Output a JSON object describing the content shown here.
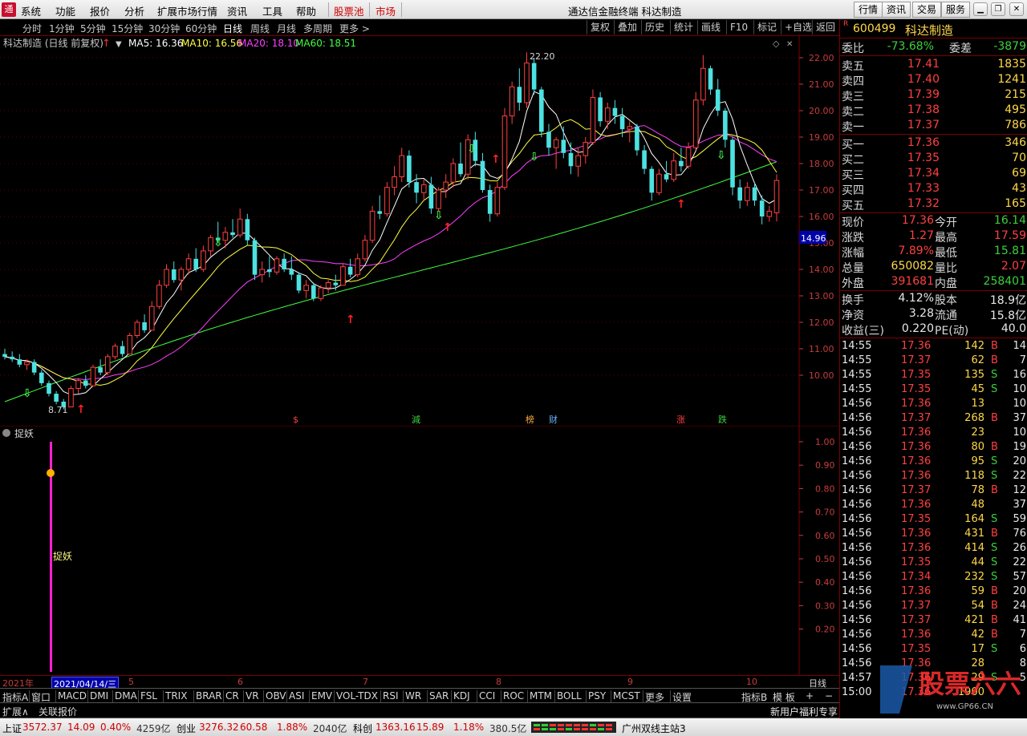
{
  "menubar": {
    "logo": "通",
    "items": [
      "系统",
      "功能",
      "报价",
      "分析",
      "扩展市场行情",
      "资讯",
      "工具",
      "帮助"
    ],
    "highlight_items": [
      "股票池",
      "市场"
    ],
    "title": "通达信金融终端  科达制造",
    "right_buttons": [
      "行情",
      "资讯",
      "交易",
      "服务"
    ]
  },
  "periodbar": {
    "periods": [
      "分时",
      "1分钟",
      "5分钟",
      "15分钟",
      "30分钟",
      "60分钟",
      "日线",
      "周线",
      "月线",
      "多周期",
      "更多 >"
    ],
    "active": "日线",
    "tools": [
      "复权",
      "叠加",
      "历史",
      "统计",
      "画线",
      "F10",
      "标记",
      "+自选",
      "返回"
    ]
  },
  "mainchart": {
    "title": "科达制造 (日线 前复权)",
    "ma_labels": [
      {
        "text": "MA5: 16.36",
        "color": "#ffffff"
      },
      {
        "text": "MA10: 16.56",
        "color": "#ffff40"
      },
      {
        "text": "MA20: 18.10",
        "color": "#ff40ff"
      },
      {
        "text": "MA60: 18.51",
        "color": "#40ff40"
      }
    ],
    "price_axis": [
      "22.00",
      "21.00",
      "20.00",
      "19.00",
      "18.00",
      "17.00",
      "16.00",
      "15.00",
      "14.00",
      "13.00",
      "12.00",
      "11.00",
      "10.00"
    ],
    "current_price_tag": "14.96",
    "high_label": "22.20",
    "low_label": "8.71",
    "event_marks": [
      {
        "text": "$",
        "color": "#ff4040"
      },
      {
        "text": "減",
        "color": "#3cd03c"
      },
      {
        "text": "榜",
        "color": "#ffaa40"
      },
      {
        "text": "财",
        "color": "#6ab4ff"
      },
      {
        "text": "涨",
        "color": "#ff4040"
      },
      {
        "text": "跌",
        "color": "#3cd03c"
      }
    ]
  },
  "subchart": {
    "title": "捉妖",
    "signal_label": "捉妖",
    "axis": [
      "1.00",
      "0.90",
      "0.80",
      "0.70",
      "0.60",
      "0.50",
      "0.40",
      "0.30",
      "0.20"
    ]
  },
  "datebar": {
    "year": "2021年",
    "cursor_date": "2021/04/14/三",
    "months": [
      "5",
      "6",
      "7",
      "8",
      "9",
      "10"
    ],
    "right_label": "日线"
  },
  "indicators": {
    "first": "指标A",
    "items": [
      "窗口",
      "MACD",
      "DMI",
      "DMA",
      "FSL",
      "TRIX",
      "BRAR",
      "CR",
      "VR",
      "OBV",
      "ASI",
      "EMV",
      "VOL-TDX",
      "RSI",
      "WR",
      "SAR",
      "KDJ",
      "CCI",
      "ROC",
      "MTM",
      "BOLL",
      "PSY",
      "MCST",
      "更多",
      "设置"
    ],
    "right_items": [
      "指标B",
      "模 板",
      "+",
      "−"
    ]
  },
  "extbar": {
    "items": [
      "扩展∧",
      "关联报价"
    ],
    "promo": "新用户福利专享"
  },
  "statusbar": {
    "sh_label": "上证",
    "sh_value": "3572.37",
    "sh_change": "14.09",
    "sh_pct": "0.40%",
    "sh_amount": "4259亿",
    "cy_label": "创业",
    "cy_value": "3276.32",
    "cy_change": "60.58",
    "cy_pct": "1.88%",
    "cy_amount": "2040亿",
    "kc_label": "科创",
    "kc_value": "1363.16",
    "kc_change": "15.89",
    "kc_pct": "1.18%",
    "kc_amount": "380.5亿",
    "server": "广州双线主站3"
  },
  "quote": {
    "badge": "R",
    "code": "600499",
    "name": "科达制造",
    "weibi_label": "委比",
    "weibi": "-73.68%",
    "weicha_label": "委差",
    "weicha": "-3879",
    "asks": [
      {
        "label": "卖五",
        "price": "17.41",
        "vol": "1835"
      },
      {
        "label": "卖四",
        "price": "17.40",
        "vol": "1241"
      },
      {
        "label": "卖三",
        "price": "17.39",
        "vol": "215"
      },
      {
        "label": "卖二",
        "price": "17.38",
        "vol": "495"
      },
      {
        "label": "卖一",
        "price": "17.37",
        "vol": "786"
      }
    ],
    "bids": [
      {
        "label": "买一",
        "price": "17.36",
        "vol": "346"
      },
      {
        "label": "买二",
        "price": "17.35",
        "vol": "70"
      },
      {
        "label": "买三",
        "price": "17.34",
        "vol": "69"
      },
      {
        "label": "买四",
        "price": "17.33",
        "vol": "43"
      },
      {
        "label": "买五",
        "price": "17.32",
        "vol": "165"
      }
    ],
    "stats": [
      {
        "l1": "现价",
        "v1": "17.36",
        "c1": "up",
        "l2": "今开",
        "v2": "16.14",
        "c2": "down"
      },
      {
        "l1": "涨跌",
        "v1": "1.27",
        "c1": "up",
        "l2": "最高",
        "v2": "17.59",
        "c2": "up"
      },
      {
        "l1": "涨幅",
        "v1": "7.89%",
        "c1": "up",
        "l2": "最低",
        "v2": "15.81",
        "c2": "down"
      },
      {
        "l1": "总量",
        "v1": "650082",
        "c1": "yel",
        "l2": "量比",
        "v2": "2.07",
        "c2": "up"
      },
      {
        "l1": "外盘",
        "v1": "391681",
        "c1": "up",
        "l2": "内盘",
        "v2": "258401",
        "c2": "down"
      }
    ],
    "stats2": [
      {
        "l1": "换手",
        "v1": "4.12%",
        "l2": "股本",
        "v2": "18.9亿"
      },
      {
        "l1": "净资",
        "v1": "3.28",
        "l2": "流通",
        "v2": "15.8亿"
      },
      {
        "l1": "收益(三)",
        "v1": "0.220",
        "l2": "PE(动)",
        "v2": "40.0"
      }
    ]
  },
  "ticks": [
    {
      "t": "14:55",
      "p": "17.36",
      "pc": "up",
      "v": "142",
      "d": "B",
      "n": "14"
    },
    {
      "t": "14:55",
      "p": "17.37",
      "pc": "up",
      "v": "62",
      "d": "B",
      "n": "7"
    },
    {
      "t": "14:55",
      "p": "17.35",
      "pc": "up",
      "v": "135",
      "d": "S",
      "n": "16"
    },
    {
      "t": "14:55",
      "p": "17.35",
      "pc": "up",
      "v": "45",
      "d": "S",
      "n": "10"
    },
    {
      "t": "14:56",
      "p": "17.36",
      "pc": "up",
      "v": "13",
      "d": "",
      "n": "10"
    },
    {
      "t": "14:56",
      "p": "17.37",
      "pc": "up",
      "v": "268",
      "d": "B",
      "n": "37"
    },
    {
      "t": "14:56",
      "p": "17.36",
      "pc": "up",
      "v": "23",
      "d": "",
      "n": "10"
    },
    {
      "t": "14:56",
      "p": "17.36",
      "pc": "up",
      "v": "80",
      "d": "B",
      "n": "19"
    },
    {
      "t": "14:56",
      "p": "17.36",
      "pc": "up",
      "v": "95",
      "d": "S",
      "n": "20"
    },
    {
      "t": "14:56",
      "p": "17.36",
      "pc": "up",
      "v": "118",
      "d": "S",
      "n": "22"
    },
    {
      "t": "14:56",
      "p": "17.37",
      "pc": "up",
      "v": "78",
      "d": "B",
      "n": "12"
    },
    {
      "t": "14:56",
      "p": "17.36",
      "pc": "up",
      "v": "48",
      "d": "",
      "n": "37"
    },
    {
      "t": "14:56",
      "p": "17.35",
      "pc": "up",
      "v": "164",
      "d": "S",
      "n": "59"
    },
    {
      "t": "14:56",
      "p": "17.36",
      "pc": "up",
      "v": "431",
      "d": "B",
      "n": "76"
    },
    {
      "t": "14:56",
      "p": "17.36",
      "pc": "up",
      "v": "414",
      "d": "S",
      "n": "26"
    },
    {
      "t": "14:56",
      "p": "17.35",
      "pc": "up",
      "v": "44",
      "d": "S",
      "n": "22"
    },
    {
      "t": "14:56",
      "p": "17.34",
      "pc": "up",
      "v": "232",
      "d": "S",
      "n": "57"
    },
    {
      "t": "14:56",
      "p": "17.36",
      "pc": "up",
      "v": "59",
      "d": "B",
      "n": "20"
    },
    {
      "t": "14:56",
      "p": "17.37",
      "pc": "up",
      "v": "54",
      "d": "B",
      "n": "24"
    },
    {
      "t": "14:56",
      "p": "17.37",
      "pc": "up",
      "v": "421",
      "d": "B",
      "n": "41"
    },
    {
      "t": "14:56",
      "p": "17.36",
      "pc": "up",
      "v": "42",
      "d": "B",
      "n": "7"
    },
    {
      "t": "14:56",
      "p": "17.35",
      "pc": "up",
      "v": "17",
      "d": "S",
      "n": "6"
    },
    {
      "t": "14:56",
      "p": "17.36",
      "pc": "up",
      "v": "28",
      "d": "",
      "n": "8"
    },
    {
      "t": "14:57",
      "p": "17.36",
      "pc": "up",
      "v": "29",
      "d": "S",
      "n": "5"
    },
    {
      "t": "15:00",
      "p": "17.36",
      "pc": "up",
      "v": "1900",
      "d": "",
      "n": ""
    }
  ],
  "watermark": "股票六六",
  "watermark_url": "www.GP66.CN",
  "colors": {
    "up": "#ff4040",
    "down": "#4de1e1",
    "ma5": "#ffffff",
    "ma10": "#ffff40",
    "ma20": "#ff40ff",
    "ma60": "#40ff40",
    "grid": "#7a0000"
  },
  "chart_data": {
    "type": "candlestick",
    "title": "科达制造 (日线 前复权)",
    "ylim": [
      8.5,
      22.5
    ],
    "x_months": [
      "4",
      "5",
      "6",
      "7",
      "8",
      "9",
      "10"
    ],
    "candles": [
      [
        10.8,
        11.0,
        10.6,
        10.7
      ],
      [
        10.7,
        10.9,
        10.5,
        10.6
      ],
      [
        10.6,
        10.8,
        10.3,
        10.4
      ],
      [
        10.4,
        10.6,
        10.2,
        10.5
      ],
      [
        10.5,
        10.6,
        10.0,
        10.1
      ],
      [
        10.1,
        10.2,
        9.6,
        9.7
      ],
      [
        9.7,
        9.8,
        9.2,
        9.3
      ],
      [
        9.3,
        9.4,
        8.9,
        9.0
      ],
      [
        9.0,
        9.1,
        8.71,
        8.8
      ],
      [
        8.8,
        9.6,
        8.8,
        9.5
      ],
      [
        9.5,
        9.9,
        9.3,
        9.8
      ],
      [
        9.8,
        10.0,
        9.5,
        9.6
      ],
      [
        9.6,
        10.4,
        9.6,
        10.3
      ],
      [
        10.3,
        10.6,
        10.0,
        10.1
      ],
      [
        10.1,
        10.8,
        10.0,
        10.7
      ],
      [
        10.7,
        11.2,
        10.6,
        11.1
      ],
      [
        11.1,
        11.3,
        10.7,
        10.8
      ],
      [
        10.8,
        11.6,
        10.8,
        11.5
      ],
      [
        11.5,
        12.1,
        11.4,
        12.0
      ],
      [
        12.0,
        12.3,
        11.6,
        11.7
      ],
      [
        11.7,
        12.8,
        11.7,
        12.6
      ],
      [
        12.6,
        13.6,
        12.5,
        13.4
      ],
      [
        13.4,
        14.2,
        13.3,
        14.0
      ],
      [
        14.0,
        14.3,
        13.5,
        13.6
      ],
      [
        13.6,
        14.1,
        13.2,
        14.0
      ],
      [
        14.0,
        14.6,
        13.8,
        14.4
      ],
      [
        14.4,
        14.8,
        13.9,
        14.0
      ],
      [
        14.0,
        14.9,
        13.9,
        14.7
      ],
      [
        14.7,
        15.3,
        14.5,
        15.2
      ],
      [
        15.2,
        15.8,
        15.0,
        15.1
      ],
      [
        15.1,
        15.6,
        14.8,
        15.4
      ],
      [
        15.4,
        15.9,
        15.2,
        15.3
      ],
      [
        15.3,
        16.3,
        15.2,
        15.9
      ],
      [
        15.9,
        16.1,
        14.9,
        15.1
      ],
      [
        15.1,
        15.2,
        13.6,
        13.8
      ],
      [
        13.8,
        14.3,
        13.5,
        14.0
      ],
      [
        14.0,
        14.5,
        13.7,
        13.9
      ],
      [
        13.9,
        14.5,
        13.8,
        14.4
      ],
      [
        14.4,
        14.6,
        13.9,
        14.0
      ],
      [
        14.0,
        14.5,
        13.6,
        13.8
      ],
      [
        13.8,
        13.9,
        13.1,
        13.2
      ],
      [
        13.2,
        13.6,
        12.9,
        13.4
      ],
      [
        13.4,
        13.5,
        12.8,
        12.9
      ],
      [
        12.9,
        13.4,
        12.8,
        13.3
      ],
      [
        13.3,
        13.6,
        13.1,
        13.5
      ],
      [
        13.5,
        13.8,
        13.2,
        13.4
      ],
      [
        13.4,
        14.2,
        13.4,
        14.1
      ],
      [
        14.1,
        14.4,
        13.7,
        13.8
      ],
      [
        13.8,
        14.6,
        13.7,
        14.4
      ],
      [
        14.4,
        15.3,
        14.3,
        15.1
      ],
      [
        15.1,
        16.4,
        15.0,
        16.2
      ],
      [
        16.2,
        16.8,
        15.9,
        16.1
      ],
      [
        16.1,
        17.3,
        16.0,
        17.1
      ],
      [
        17.1,
        17.9,
        16.8,
        17.5
      ],
      [
        17.5,
        18.6,
        17.3,
        18.3
      ],
      [
        18.3,
        18.5,
        17.1,
        17.3
      ],
      [
        17.3,
        17.6,
        16.5,
        16.9
      ],
      [
        16.9,
        17.4,
        16.6,
        17.2
      ],
      [
        17.2,
        17.5,
        16.1,
        16.3
      ],
      [
        16.3,
        17.1,
        16.2,
        17.0
      ],
      [
        17.0,
        17.6,
        16.7,
        17.3
      ],
      [
        17.3,
        18.2,
        17.1,
        18.0
      ],
      [
        18.0,
        18.8,
        17.5,
        17.6
      ],
      [
        17.6,
        19.1,
        17.4,
        18.9
      ],
      [
        18.9,
        19.2,
        17.9,
        18.1
      ],
      [
        18.1,
        18.4,
        16.9,
        17.0
      ],
      [
        17.0,
        17.2,
        15.8,
        16.1
      ],
      [
        16.1,
        17.3,
        16.0,
        17.1
      ],
      [
        17.1,
        20.1,
        17.0,
        19.8
      ],
      [
        19.8,
        21.1,
        19.5,
        20.9
      ],
      [
        20.9,
        21.6,
        20.0,
        20.3
      ],
      [
        20.3,
        22.2,
        20.1,
        21.8
      ],
      [
        21.8,
        22.0,
        20.6,
        20.8
      ],
      [
        20.8,
        20.9,
        19.0,
        19.2
      ],
      [
        19.2,
        19.5,
        18.3,
        18.6
      ],
      [
        18.6,
        19.0,
        17.8,
        18.9
      ],
      [
        18.9,
        19.4,
        18.2,
        18.4
      ],
      [
        18.4,
        18.8,
        17.6,
        17.9
      ],
      [
        17.9,
        18.6,
        17.5,
        18.3
      ],
      [
        18.3,
        19.0,
        18.0,
        18.8
      ],
      [
        18.8,
        20.8,
        18.7,
        20.5
      ],
      [
        20.5,
        20.7,
        19.4,
        19.6
      ],
      [
        19.6,
        20.3,
        19.3,
        20.1
      ],
      [
        20.1,
        20.4,
        19.5,
        19.8
      ],
      [
        19.8,
        20.1,
        19.0,
        19.3
      ],
      [
        19.3,
        19.6,
        18.8,
        19.4
      ],
      [
        19.4,
        19.5,
        18.3,
        18.5
      ],
      [
        18.5,
        18.7,
        17.6,
        17.8
      ],
      [
        17.8,
        17.9,
        16.6,
        16.9
      ],
      [
        16.9,
        17.8,
        16.8,
        17.6
      ],
      [
        17.6,
        18.1,
        17.3,
        17.4
      ],
      [
        17.4,
        18.4,
        17.3,
        18.1
      ],
      [
        18.1,
        18.6,
        17.7,
        17.9
      ],
      [
        17.9,
        18.8,
        17.8,
        18.6
      ],
      [
        18.6,
        20.7,
        18.5,
        20.4
      ],
      [
        20.4,
        22.1,
        20.2,
        21.6
      ],
      [
        21.6,
        21.7,
        20.6,
        20.8
      ],
      [
        20.8,
        21.2,
        19.8,
        20.0
      ],
      [
        20.0,
        20.1,
        18.6,
        18.9
      ],
      [
        18.9,
        19.0,
        16.8,
        17.1
      ],
      [
        17.1,
        17.4,
        16.3,
        16.6
      ],
      [
        16.6,
        17.3,
        16.4,
        17.1
      ],
      [
        17.1,
        17.3,
        16.4,
        16.6
      ],
      [
        16.6,
        16.8,
        15.7,
        16.0
      ],
      [
        16.0,
        16.4,
        15.8,
        16.2
      ],
      [
        16.14,
        17.59,
        15.81,
        17.36
      ]
    ]
  }
}
